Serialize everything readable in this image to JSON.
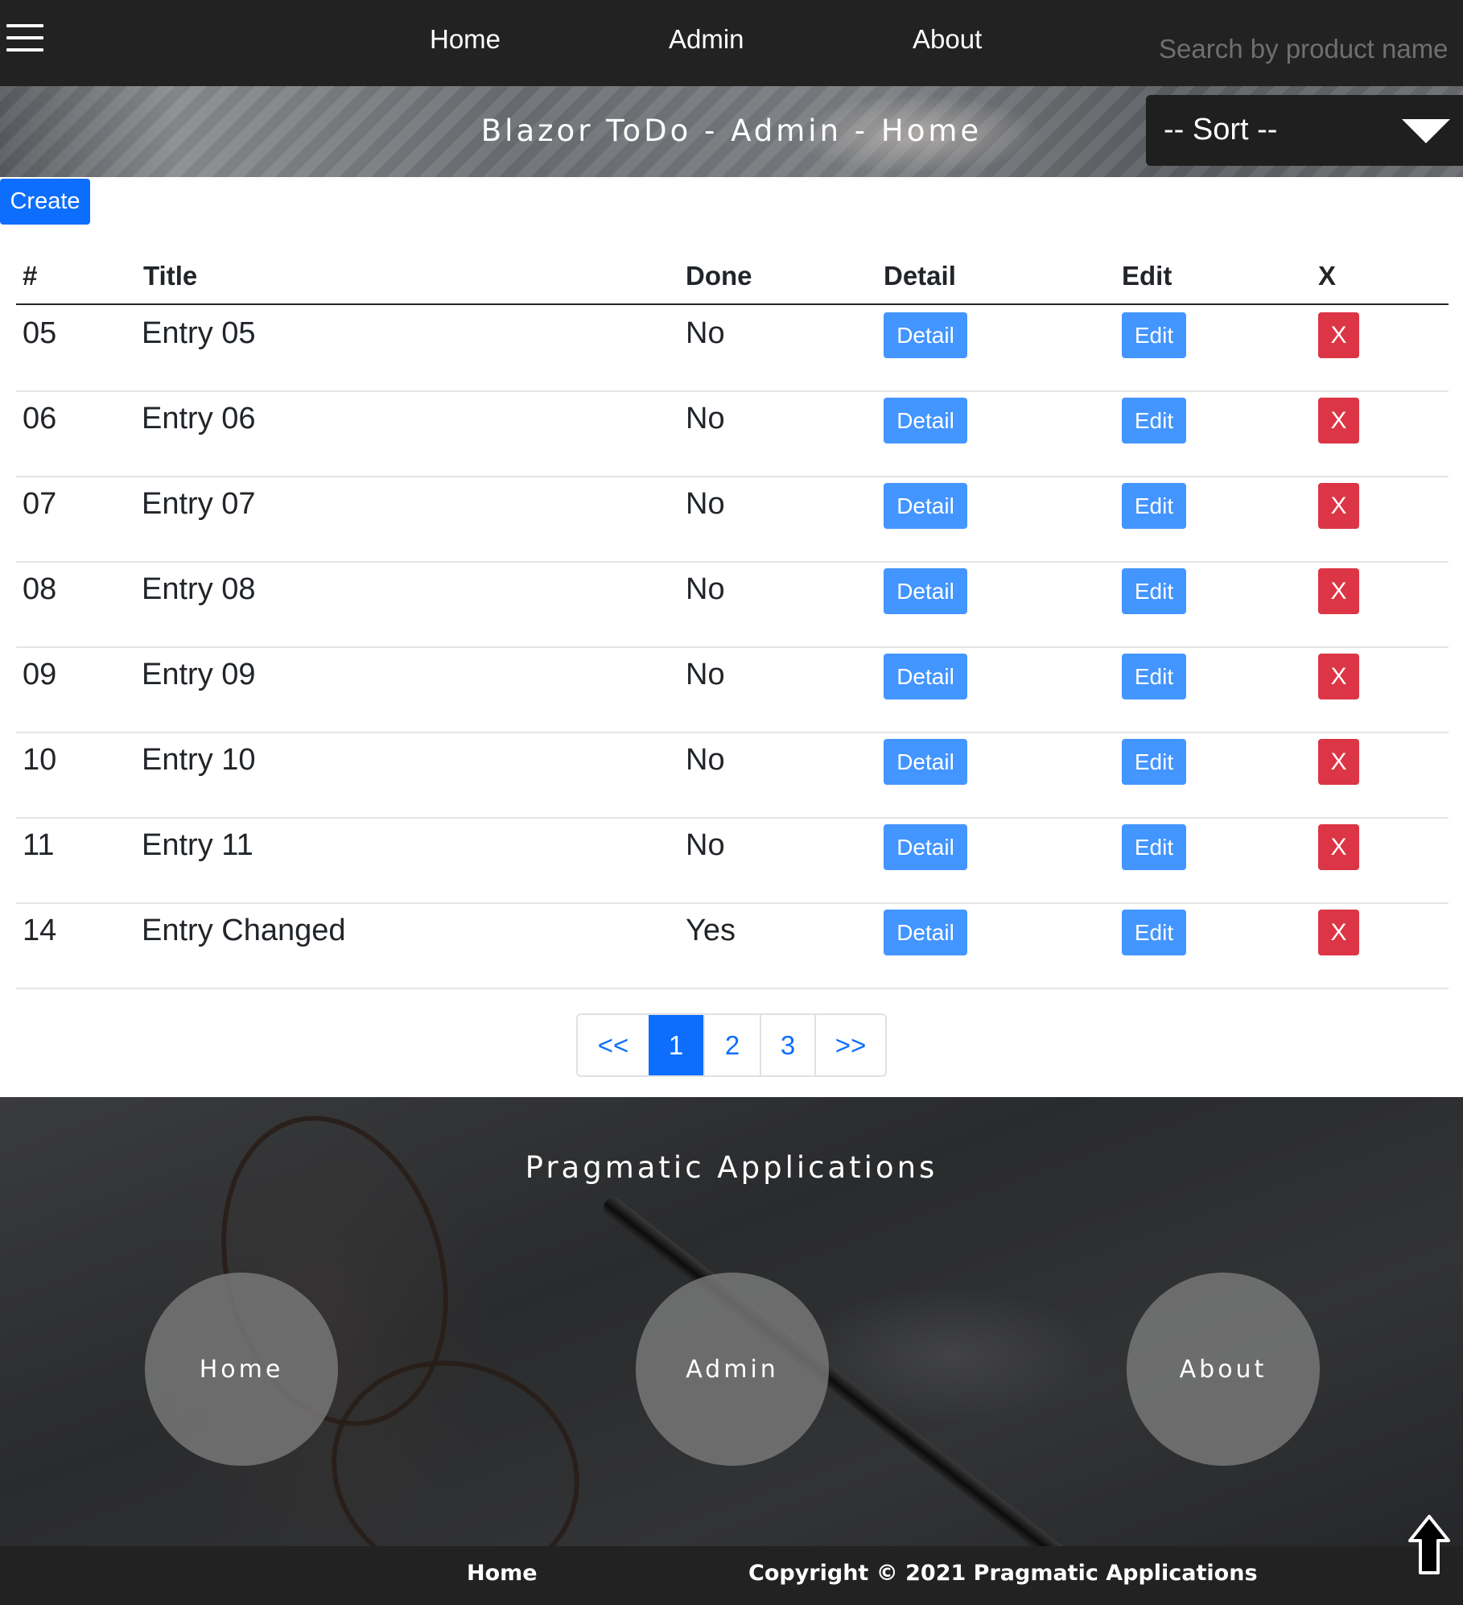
{
  "navbar": {
    "menu_icon": "hamburger-icon",
    "links": [
      "Home",
      "Admin",
      "About"
    ],
    "search_placeholder": "Search by product name"
  },
  "banner": {
    "title": "Blazor ToDo - Admin - Home",
    "sort_label": "-- Sort --",
    "sort_icon": "caret-down-icon"
  },
  "create_label": "Create",
  "table": {
    "headers": [
      "#",
      "Title",
      "Done",
      "Detail",
      "Edit",
      "X"
    ],
    "rows": [
      {
        "id": "05",
        "title": "Entry 05",
        "done": "No",
        "detail": "Detail",
        "edit": "Edit",
        "delete": "X"
      },
      {
        "id": "06",
        "title": "Entry 06",
        "done": "No",
        "detail": "Detail",
        "edit": "Edit",
        "delete": "X"
      },
      {
        "id": "07",
        "title": "Entry 07",
        "done": "No",
        "detail": "Detail",
        "edit": "Edit",
        "delete": "X"
      },
      {
        "id": "08",
        "title": "Entry 08",
        "done": "No",
        "detail": "Detail",
        "edit": "Edit",
        "delete": "X"
      },
      {
        "id": "09",
        "title": "Entry 09",
        "done": "No",
        "detail": "Detail",
        "edit": "Edit",
        "delete": "X"
      },
      {
        "id": "10",
        "title": "Entry 10",
        "done": "No",
        "detail": "Detail",
        "edit": "Edit",
        "delete": "X"
      },
      {
        "id": "11",
        "title": "Entry 11",
        "done": "No",
        "detail": "Detail",
        "edit": "Edit",
        "delete": "X"
      },
      {
        "id": "14",
        "title": "Entry Changed",
        "done": "Yes",
        "detail": "Detail",
        "edit": "Edit",
        "delete": "X"
      }
    ]
  },
  "pagination": {
    "prev": "<<",
    "pages": [
      "1",
      "2",
      "3"
    ],
    "active": "1",
    "next": ">>"
  },
  "footer": {
    "title": "Pragmatic Applications",
    "circles": [
      "Home",
      "Admin",
      "About"
    ]
  },
  "bottombar": {
    "link": "Home",
    "copyright": "Copyright © 2021 Pragmatic Applications",
    "scroll_top_icon": "arrow-up-icon"
  },
  "colors": {
    "navbar_bg": "#222222",
    "primary": "#0d6efd",
    "button_blue": "#4395ff",
    "danger": "#dc3545"
  }
}
